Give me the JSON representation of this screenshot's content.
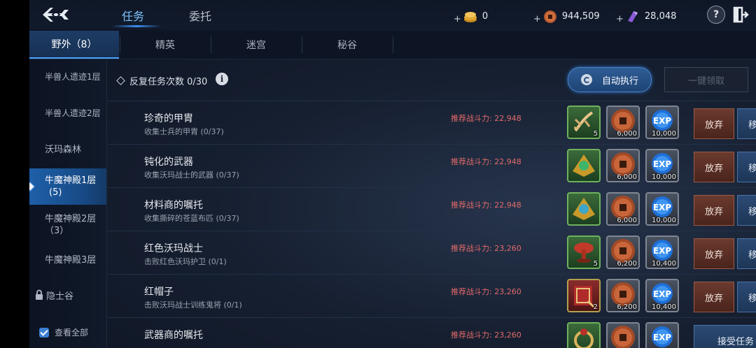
{
  "header": {
    "tabs": [
      {
        "label": "任务",
        "active": true
      },
      {
        "label": "委托",
        "active": false
      }
    ],
    "currencies": [
      {
        "icon": "gold-coin-icon",
        "value": "0"
      },
      {
        "icon": "bronze-coin-icon",
        "value": "944,509"
      },
      {
        "icon": "purple-crystal-icon",
        "value": "28,048"
      }
    ],
    "plus": "+",
    "help": "?"
  },
  "subtabs": [
    {
      "label": "野外（8）",
      "active": true
    },
    {
      "label": "精英"
    },
    {
      "label": "迷宫"
    },
    {
      "label": "秘谷"
    }
  ],
  "sidebar": {
    "items": [
      {
        "label": "半兽人遗迹1层"
      },
      {
        "label": "半兽人遗迹2层"
      },
      {
        "label": "沃玛森林"
      },
      {
        "label": "牛魔神殿1层",
        "sub": "(5)",
        "active": true
      },
      {
        "label": "牛魔神殿2层",
        "sub": "（3）"
      },
      {
        "label": "牛魔神殿3层"
      },
      {
        "label": "隐士谷",
        "locked": true
      }
    ],
    "view_all": "查看全部"
  },
  "repeat": {
    "label": "反复任务次数 0/30",
    "info": "i",
    "auto_button": "自动执行",
    "claim_all_button": "一键领取"
  },
  "quests": [
    {
      "name": "珍奇的甲胄",
      "desc": "收集士兵的甲胄 (0/37)",
      "power_label": "推荐战斗力:",
      "power": "22,948",
      "rewards": [
        {
          "icon": "herb-root-icon",
          "qty": "5",
          "frame": "green"
        },
        {
          "icon": "bronze-coin-icon",
          "qty": "6,000",
          "frame": "gray"
        },
        {
          "icon": "exp-icon",
          "qty": "10,000",
          "frame": "gray"
        }
      ],
      "actions": [
        "放弃",
        "移动"
      ]
    },
    {
      "name": "钝化的武器",
      "desc": "收集沃玛战士的武器 (0/37)",
      "power_label": "推荐战斗力:",
      "power": "22,948",
      "rewards": [
        {
          "icon": "green-gem-icon",
          "qty": "",
          "frame": "green"
        },
        {
          "icon": "bronze-coin-icon",
          "qty": "6,000",
          "frame": "gray"
        },
        {
          "icon": "exp-icon",
          "qty": "10,000",
          "frame": "gray"
        }
      ],
      "actions": [
        "放弃",
        "移动"
      ]
    },
    {
      "name": "材料商的嘱托",
      "desc": "收集撕碎的苍蓝布匹 (0/37)",
      "power_label": "推荐战斗力:",
      "power": "22,948",
      "rewards": [
        {
          "icon": "blue-gem-icon",
          "qty": "",
          "frame": "green"
        },
        {
          "icon": "bronze-coin-icon",
          "qty": "6,000",
          "frame": "gray"
        },
        {
          "icon": "exp-icon",
          "qty": "10,000",
          "frame": "gray"
        }
      ],
      "actions": [
        "放弃",
        "移动"
      ]
    },
    {
      "name": "红色沃玛战士",
      "desc": "击败红色沃玛护卫 (0/1)",
      "power_label": "推荐战斗力:",
      "power": "23,260",
      "rewards": [
        {
          "icon": "red-mushroom-icon",
          "qty": "5",
          "frame": "green"
        },
        {
          "icon": "bronze-coin-icon",
          "qty": "6,200",
          "frame": "gray"
        },
        {
          "icon": "exp-icon",
          "qty": "10,400",
          "frame": "gray"
        }
      ],
      "actions": [
        "放弃",
        "移动"
      ]
    },
    {
      "name": "红帽子",
      "desc": "击败沃玛战士训练鬼将 (0/1)",
      "power_label": "推荐战斗力:",
      "power": "23,260",
      "rewards": [
        {
          "icon": "red-scroll-icon",
          "qty": "2",
          "frame": "red"
        },
        {
          "icon": "bronze-coin-icon",
          "qty": "6,200",
          "frame": "gray"
        },
        {
          "icon": "exp-icon",
          "qty": "10,400",
          "frame": "gray"
        }
      ],
      "actions": [
        "放弃",
        "移动"
      ]
    },
    {
      "name": "武器商的嘱托",
      "desc": "",
      "power_label": "推荐战斗力:",
      "power": "23,260",
      "rewards": [
        {
          "icon": "ring-icon",
          "qty": "",
          "frame": "green"
        },
        {
          "icon": "bronze-coin-icon",
          "qty": "",
          "frame": "gray"
        },
        {
          "icon": "exp-icon",
          "qty": "",
          "frame": "gray"
        }
      ],
      "actions": [
        "接受任务"
      ]
    }
  ],
  "colors": {
    "accent": "#3b8ff0",
    "power": "#e36a6a",
    "abandon": "#6b3a2e",
    "move": "#2c4a74"
  }
}
